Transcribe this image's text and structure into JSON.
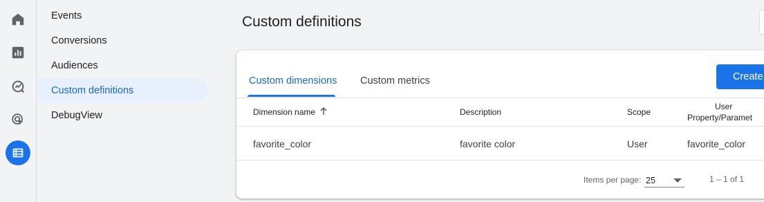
{
  "nav": {
    "items": [
      {
        "label": "Events"
      },
      {
        "label": "Conversions"
      },
      {
        "label": "Audiences"
      },
      {
        "label": "Custom definitions"
      },
      {
        "label": "DebugView"
      }
    ],
    "rail_icons": [
      "home-icon",
      "reports-icon",
      "explore-icon",
      "advertising-icon",
      "configure-icon"
    ]
  },
  "page": {
    "title": "Custom definitions"
  },
  "tabs": [
    {
      "label": "Custom dimensions",
      "active": true
    },
    {
      "label": "Custom metrics",
      "active": false
    }
  ],
  "create_button": {
    "label": "Create"
  },
  "table": {
    "headers": [
      "Dimension name",
      "Description",
      "Scope",
      "User",
      "Property/Paramet"
    ],
    "rows": [
      [
        "favorite_color",
        "favorite color",
        "User",
        "favorite_color"
      ]
    ]
  },
  "pagination": {
    "items_per_page_label": "Items per page:",
    "items_per_page_value": "25",
    "range": "1 – 1 of 1"
  },
  "colors": {
    "accent": "#1a73e8",
    "active_nav_bg": "#e8f0fe",
    "active_text": "#1967d2"
  }
}
